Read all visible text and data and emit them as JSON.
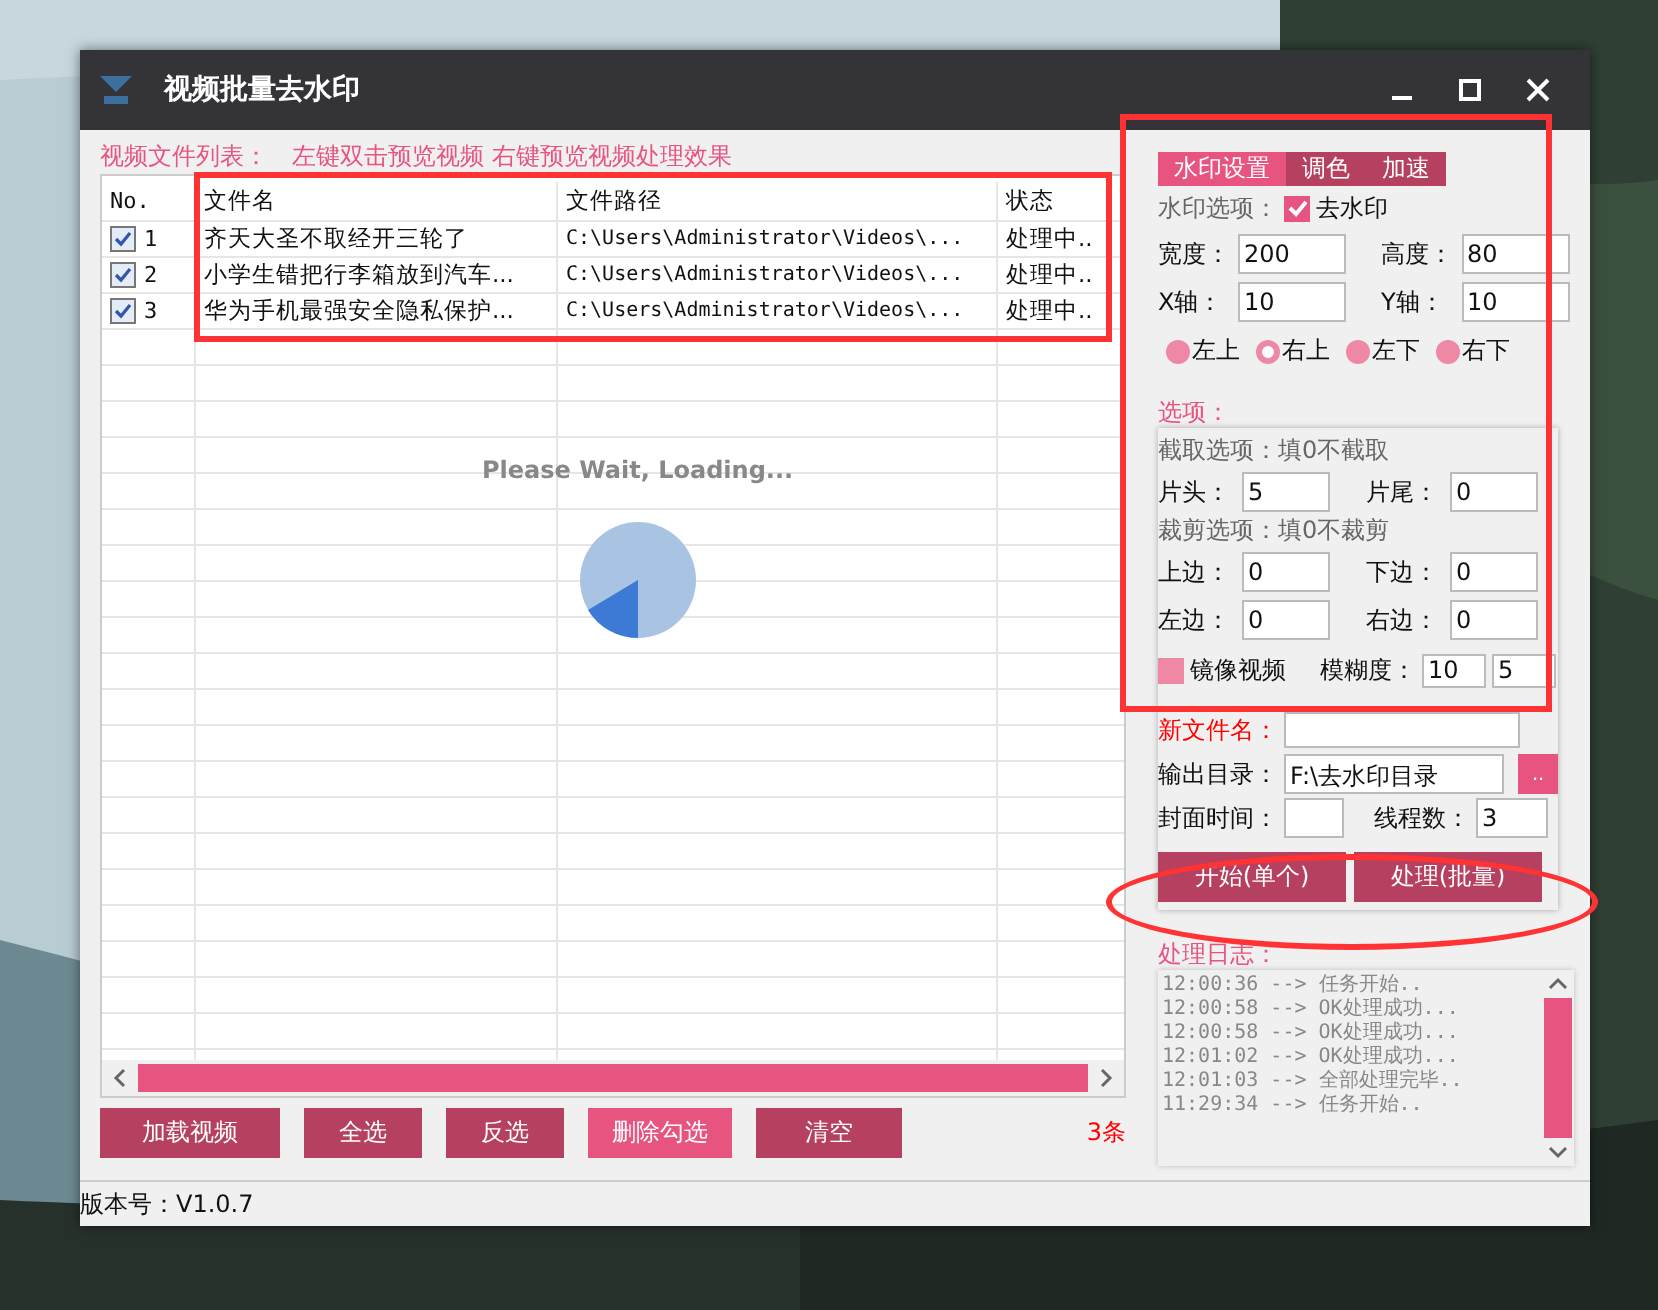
{
  "window": {
    "title": "视频批量去水印"
  },
  "file_list": {
    "label": "视频文件列表：",
    "hint": "左键双击预览视频 右键预览视频处理效果",
    "columns": [
      "No.",
      "文件名",
      "文件路径",
      "状态"
    ],
    "rows": [
      {
        "checked": true,
        "no": "1",
        "name": "齐天大圣不取经开三轮了",
        "path": "C:\\Users\\Administrator\\Videos\\...",
        "status": "处理中.."
      },
      {
        "checked": true,
        "no": "2",
        "name": "小学生错把行李箱放到汽车...",
        "path": "C:\\Users\\Administrator\\Videos\\...",
        "status": "处理中.."
      },
      {
        "checked": true,
        "no": "3",
        "name": "华为手机最强安全隐私保护...",
        "path": "C:\\Users\\Administrator\\Videos\\...",
        "status": "处理中.."
      }
    ],
    "loading": "Please Wait, Loading...",
    "buttons": [
      {
        "label": "加载视频",
        "highlighted": false
      },
      {
        "label": "全选",
        "highlighted": false
      },
      {
        "label": "反选",
        "highlighted": false
      },
      {
        "label": "删除勾选",
        "highlighted": true
      },
      {
        "label": "清空",
        "highlighted": false
      }
    ],
    "count": "3条"
  },
  "settings": {
    "tabs": [
      {
        "label": "水印设置",
        "selected": true
      },
      {
        "label": "调色",
        "selected": false
      },
      {
        "label": "加速",
        "selected": false
      }
    ],
    "watermark_label": "水印选项：",
    "remove_watermark": {
      "label": "去水印",
      "checked": true
    },
    "fields": [
      {
        "label": "宽度：",
        "value": "200"
      },
      {
        "label": "高度：",
        "value": "80"
      },
      {
        "label": "X轴：",
        "value": "10"
      },
      {
        "label": "Y轴：",
        "value": "10"
      }
    ],
    "positions": [
      {
        "label": "左上",
        "selected": false
      },
      {
        "label": "右上",
        "selected": true
      },
      {
        "label": "左下",
        "selected": false
      },
      {
        "label": "右下",
        "selected": false
      }
    ]
  },
  "options": {
    "label": "选项：",
    "trim_hint": "截取选项：填0不截取",
    "trim_fields": [
      {
        "label": "片头：",
        "value": "5"
      },
      {
        "label": "片尾：",
        "value": "0"
      }
    ],
    "crop_hint": "裁剪选项：填0不裁剪",
    "crop_fields": [
      {
        "label": "上边：",
        "value": "0"
      },
      {
        "label": "下边：",
        "value": "0"
      },
      {
        "label": "左边：",
        "value": "0"
      },
      {
        "label": "右边：",
        "value": "0"
      }
    ],
    "mirror": {
      "label": "镜像视频",
      "checked": false
    },
    "blur": {
      "label": "模糊度：",
      "values": [
        "10",
        "5"
      ]
    }
  },
  "output": {
    "new_name_label": "新文件名：",
    "dir_label": "输出目录：",
    "dir_value": "F:\\去水印目录",
    "browse": "..",
    "cover_label": "封面时间：",
    "threads_label": "线程数：",
    "threads_value": "3"
  },
  "actions": [
    "开始(单个)",
    "处理(批量)"
  ],
  "log": {
    "label": "处理日志：",
    "lines": [
      "12:00:36 --> 任务开始..",
      "12:00:58 --> OK处理成功...",
      "12:00:58 --> OK处理成功...",
      "12:01:02 --> OK处理成功...",
      "12:01:03 --> 全部处理完毕..",
      "11:29:34 --> 任务开始.."
    ]
  },
  "status_bar": "版本号：V1.0.7"
}
